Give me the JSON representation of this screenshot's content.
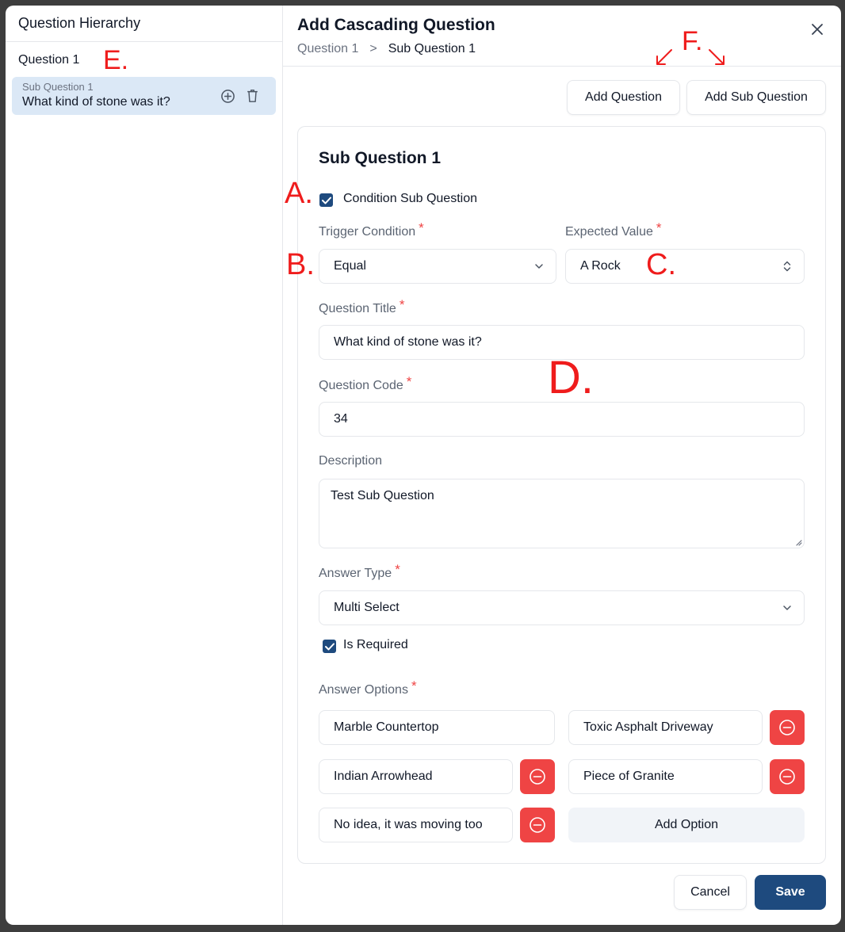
{
  "sidebar": {
    "title": "Question Hierarchy",
    "question_label": "Question 1",
    "sub_item": {
      "caption": "Sub Question 1",
      "text": "What kind of stone was it?"
    }
  },
  "header": {
    "title": "Add Cascading Question",
    "breadcrumb": [
      "Question 1",
      "Sub Question 1"
    ],
    "breadcrumb_separator": ">"
  },
  "toolbar": {
    "add_question": "Add Question",
    "add_sub_question": "Add Sub Question"
  },
  "form": {
    "title": "Sub Question 1",
    "condition_checkbox": {
      "label": "Condition Sub Question",
      "checked": true
    },
    "trigger_condition": {
      "label": "Trigger Condition",
      "value": "Equal"
    },
    "expected_value": {
      "label": "Expected Value",
      "value": "A Rock"
    },
    "question_title": {
      "label": "Question Title",
      "value": "What kind of stone was it?"
    },
    "question_code": {
      "label": "Question Code",
      "value": "34"
    },
    "description": {
      "label": "Description",
      "value": "Test Sub Question"
    },
    "answer_type": {
      "label": "Answer Type",
      "value": "Multi Select"
    },
    "is_required": {
      "label": "Is Required",
      "checked": true
    },
    "answer_options": {
      "label": "Answer Options",
      "options": [
        "Marble Countertop",
        "Toxic Asphalt Driveway",
        "Indian Arrowhead",
        "Piece of Granite",
        "No idea, it was moving too"
      ],
      "add_label": "Add Option"
    },
    "required_marker": "*"
  },
  "footer": {
    "cancel": "Cancel",
    "save": "Save"
  },
  "annotations": {
    "a": "A.",
    "b": "B.",
    "c": "C.",
    "d": "D.",
    "e": "E.",
    "f": "F."
  },
  "colors": {
    "primary": "#1e4a7e",
    "danger": "#ef4444",
    "selected_bg": "#dbe8f6",
    "annotation": "#ef1c1c"
  }
}
